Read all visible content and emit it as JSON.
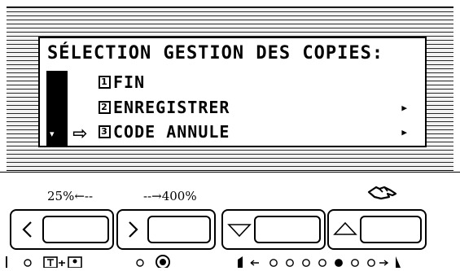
{
  "lcd": {
    "title": "SÉLECTION GESTION DES COPIES:",
    "items": [
      {
        "number": "1",
        "label": "FIN",
        "has_submenu": false,
        "selected": false
      },
      {
        "number": "2",
        "label": "ENREGISTRER",
        "has_submenu": true,
        "selected": false
      },
      {
        "number": "3",
        "label": "CODE ANNULE",
        "has_submenu": true,
        "selected": true
      }
    ],
    "submenu_glyph": "▶",
    "cursor_glyph": "⇨",
    "cursor_mark": "▾"
  },
  "zoom": {
    "min_label": "25%←--",
    "max_label": "--→400%"
  },
  "keys": [
    {
      "name": "zoom-down",
      "symbol": "<"
    },
    {
      "name": "zoom-up",
      "symbol": ">"
    },
    {
      "name": "arrow-down",
      "symbol": "▽"
    },
    {
      "name": "arrow-up",
      "symbol": "△"
    }
  ],
  "icons": {
    "hand": "hand-icon",
    "key_left": "chevron-left-icon",
    "key_right": "chevron-right-icon",
    "key_down": "triangle-down-icon",
    "key_up": "triangle-up-icon"
  },
  "status": {
    "exposure_level": 5,
    "exposure_steps": 7
  }
}
